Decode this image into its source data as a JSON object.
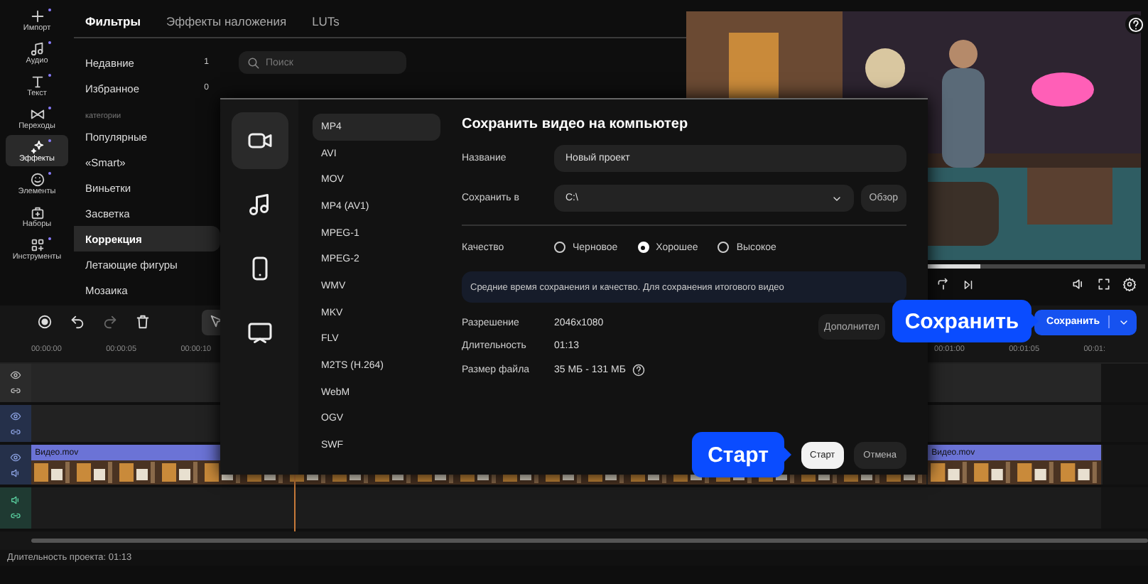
{
  "nav": [
    {
      "label": "Импорт",
      "selected": false,
      "new": true
    },
    {
      "label": "Аудио",
      "selected": false,
      "new": true
    },
    {
      "label": "Текст",
      "selected": false,
      "new": true
    },
    {
      "label": "Переходы",
      "selected": false,
      "new": true
    },
    {
      "label": "Эффекты",
      "selected": true,
      "new": true
    },
    {
      "label": "Элементы",
      "selected": false,
      "new": true
    },
    {
      "label": "Наборы",
      "selected": false,
      "new": false
    },
    {
      "label": "Инструменты",
      "selected": false,
      "new": true
    }
  ],
  "panel_tabs": [
    {
      "label": "Фильтры",
      "selected": true
    },
    {
      "label": "Эффекты наложения",
      "selected": false
    },
    {
      "label": "LUTs",
      "selected": false
    }
  ],
  "pinned": [
    {
      "label": "Недавние",
      "count": "1"
    },
    {
      "label": "Избранное",
      "count": "0"
    }
  ],
  "categories_heading": "категории",
  "categories": [
    {
      "label": "Популярные",
      "selected": false
    },
    {
      "label": "«Smart»",
      "selected": false
    },
    {
      "label": "Виньетки",
      "selected": false
    },
    {
      "label": "Засветка",
      "selected": false
    },
    {
      "label": "Коррекция",
      "selected": true
    },
    {
      "label": "Летающие фигуры",
      "selected": false
    },
    {
      "label": "Мозаика",
      "selected": false
    }
  ],
  "search": {
    "placeholder": "Поиск"
  },
  "preview": {
    "kind": "picture",
    "progress": {
      "level": 0.64
    }
  },
  "toolbar": [
    {
      "kind": "record",
      "disabled": false,
      "selected": false
    },
    {
      "kind": "undo",
      "disabled": false,
      "selected": false
    },
    {
      "kind": "redo",
      "disabled": true,
      "selected": false
    },
    {
      "kind": "delete",
      "disabled": false,
      "selected": false
    },
    {
      "kind": "select",
      "disabled": false,
      "selected": true
    }
  ],
  "save_button": {
    "label": "Сохранить"
  },
  "ruler_start": [
    "00:00:00",
    "00:00:05",
    "00:00:10"
  ],
  "ruler_end": [
    "00:01:00",
    "00:01:05",
    "00:01:"
  ],
  "tracks": [
    {
      "kind": "overlay"
    },
    {
      "kind": "text"
    },
    {
      "kind": "video",
      "clips": [
        {
          "label": "Видео.mov"
        },
        {
          "label": "Видео.mov"
        }
      ]
    },
    {
      "kind": "audio"
    }
  ],
  "status": "Длительность проекта: 01:13",
  "dialog": {
    "title": "Сохранить видео на компьютер",
    "categories": [
      {
        "kind": "video",
        "selected": true
      },
      {
        "kind": "audio",
        "selected": false
      },
      {
        "kind": "phone",
        "selected": false
      },
      {
        "kind": "tv",
        "selected": false
      }
    ],
    "formats": [
      {
        "label": "MP4",
        "selected": true
      },
      {
        "label": "AVI",
        "selected": false
      },
      {
        "label": "MOV",
        "selected": false
      },
      {
        "label": "MP4 (AV1)",
        "selected": false
      },
      {
        "label": "MPEG-1",
        "selected": false
      },
      {
        "label": "MPEG-2",
        "selected": false
      },
      {
        "label": "WMV",
        "selected": false
      },
      {
        "label": "MKV",
        "selected": false
      },
      {
        "label": "FLV",
        "selected": false
      },
      {
        "label": "M2TS (H.264)",
        "selected": false
      },
      {
        "label": "WebM",
        "selected": false
      },
      {
        "label": "OGV",
        "selected": false
      },
      {
        "label": "SWF",
        "selected": false
      }
    ],
    "name_label": "Название",
    "name_value": "Новый проект",
    "path_label": "Сохранить в",
    "path_value": "C:\\",
    "browse": "Обзор",
    "quality": {
      "label": "Качество",
      "options": [
        {
          "label": "Черновое",
          "selected": false
        },
        {
          "label": "Хорошее",
          "selected": true
        },
        {
          "label": "Высокое",
          "selected": false
        }
      ]
    },
    "hint": "Средние время сохранения и качество. Для сохранения итогового видео",
    "info": [
      {
        "label": "Разрешение",
        "value": "2046x1080"
      },
      {
        "label": "Длительность",
        "value": "01:13"
      },
      {
        "label": "Размер файла",
        "value": "35 МБ - 131 МБ"
      }
    ],
    "more_button": "Дополнител",
    "start": "Старт",
    "cancel": "Отмена"
  },
  "callouts": {
    "start": "Старт",
    "save": "Сохранить"
  }
}
